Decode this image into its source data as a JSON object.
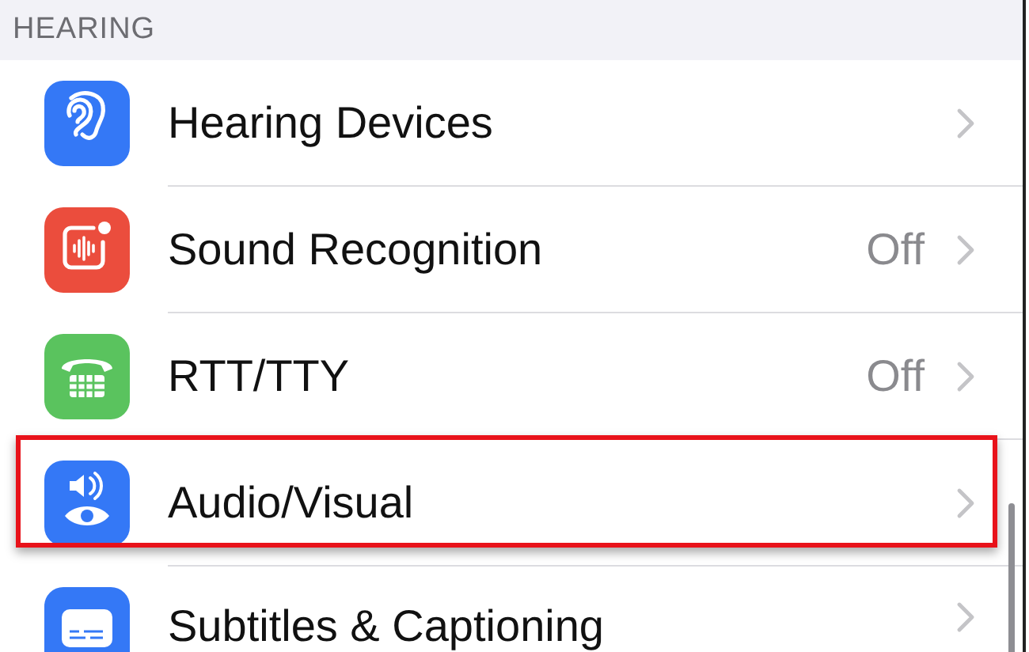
{
  "section": {
    "header": "HEARING"
  },
  "items": [
    {
      "kind": "ear",
      "color": "#3478f6",
      "label": "Hearing Devices",
      "highlighted": false
    },
    {
      "kind": "waveform",
      "color": "#eb4d3d",
      "label": "Sound Recognition",
      "value": "Off",
      "highlighted": false
    },
    {
      "kind": "tty",
      "color": "#5ac35e",
      "label": "RTT/TTY",
      "value": "Off",
      "highlighted": false
    },
    {
      "kind": "audio-visual",
      "color": "#3478f6",
      "label": "Audio/Visual",
      "highlighted": true
    },
    {
      "kind": "subtitles",
      "color": "#3478f6",
      "label": "Subtitles & Captioning",
      "highlighted": false
    }
  ]
}
